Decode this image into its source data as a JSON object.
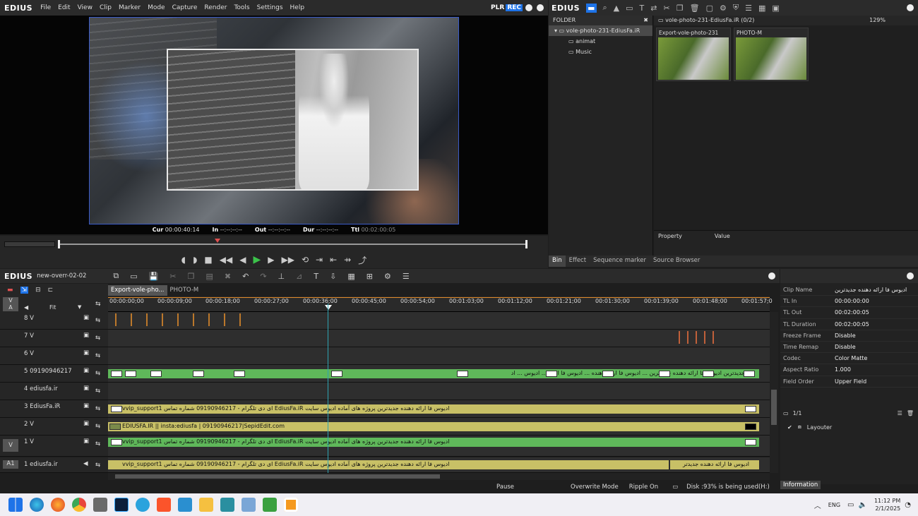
{
  "preview_window": {
    "logo": "EDIUS",
    "menu": [
      "File",
      "Edit",
      "View",
      "Clip",
      "Marker",
      "Mode",
      "Capture",
      "Render",
      "Tools",
      "Settings",
      "Help"
    ],
    "plr": "PLR",
    "rec": "REC",
    "timecodes": {
      "cur_label": "Cur",
      "cur": "00:00:40:14",
      "in_label": "In",
      "in": "--:--:--:--",
      "out_label": "Out",
      "out": "--:--:--:--",
      "dur_label": "Dur",
      "dur": "--:--:--:--",
      "ttl_label": "Ttl",
      "ttl": "00:02:00:05"
    }
  },
  "bin": {
    "logo": "EDIUS",
    "folder_header": "FOLDER",
    "root": "vole-photo-231-EdiusFa.iR",
    "folders": [
      "animat",
      "Music"
    ],
    "path": "vole-photo-231-EdiusFa.iR (0/2)",
    "zoom": "129%",
    "clips": [
      {
        "name": "Export-vole-photo-231"
      },
      {
        "name": "PHOTO-M"
      }
    ],
    "prop_cols": [
      "Property",
      "Value"
    ],
    "tabs": [
      "Bin",
      "Effect",
      "Sequence marker",
      "Source Browser"
    ]
  },
  "timeline": {
    "logo": "EDIUS",
    "project": "new-overr-02-02",
    "seq_tabs": [
      "Export-vole-pho...",
      "PHOTO-M"
    ],
    "fit": "Fit",
    "ruler": [
      "00:00:00;00",
      "00:00:09;00",
      "00:00:18;00",
      "00:00:27;00",
      "00:00:36;00",
      "00:00:45;00",
      "00:00:54;00",
      "00:01:03;00",
      "00:01:12;00",
      "00:01:21;00",
      "00:01:30;00",
      "00:01:39;00",
      "00:01:48;00",
      "00:01:57;0"
    ],
    "tracks": [
      {
        "name": "8 V"
      },
      {
        "name": "7 V"
      },
      {
        "name": "6 V"
      },
      {
        "name": "5 09190946217",
        "clip_text": "جدیدترین  ادیوس فا ارائه دهنده جدیدترین ... ادیوس فا ارائه دهنده ... ادیوس فا ارائه ... ادیوس ... اد"
      },
      {
        "name": "4 ediusfa.ir"
      },
      {
        "name": "3 EdiusFa.iR",
        "clip_text": "ادیوس فا ارائه دهنده جدیدترین پروژه های آماده ادیوس سایت EdiusFa.iR  ای دی تلگرام - 09190946217 شماره تماس  vvip_support1"
      },
      {
        "name": "2 V",
        "clip_text": "EDIUSFA.IR || insta:ediusfa |  09190946217|SepidEdit.com"
      },
      {
        "name": "1 V",
        "clip_text": "ادیوس فا ارائه دهنده جدیدترین پروژه های آماده ادیوس سایت EdiusFa.iR  ای دی تلگرام - 09190946217 شماره تماس  vvip_support1"
      },
      {
        "name": "1 ediusfa.ir",
        "clip_text": "ادیوس فا ارائه دهنده جدیدترین پروژه های آماده ادیوس سایت EdiusFa.iR  ای دی تلگرام - 09190946217 شماره تماس  vvip_support1",
        "clip_text2": "ادیوس فا ارائه دهنده جدیدتر"
      }
    ],
    "track_labels": {
      "v": "V",
      "a": "A",
      "a1": "A1"
    }
  },
  "info": {
    "rows": [
      {
        "k": "Clip Name",
        "v": "ادیوس فا ارائه دهنده جدیدترین"
      },
      {
        "k": "TL In",
        "v": "00:00:00:00"
      },
      {
        "k": "TL Out",
        "v": "00:02:00:05"
      },
      {
        "k": "TL Duration",
        "v": "00:02:00:05"
      },
      {
        "k": "Freeze Frame",
        "v": "Disable"
      },
      {
        "k": "Time Remap",
        "v": "Disable"
      },
      {
        "k": "Codec",
        "v": "Color Matte"
      },
      {
        "k": "Aspect Ratio",
        "v": "1.000"
      },
      {
        "k": "Field Order",
        "v": "Upper Field"
      }
    ],
    "page": "1/1",
    "layouter": "Layouter",
    "tab": "Information"
  },
  "status": {
    "pause": "Pause",
    "overwrite": "Overwrite Mode",
    "ripple": "Ripple On",
    "disk": "Disk :93% is being used(H:)"
  },
  "taskbar": {
    "lang": "ENG",
    "time": "11:12 PM",
    "date": "2/1/2025"
  },
  "colors": {
    "green_clip": "#5fb85a",
    "yellow_clip": "#c8c066",
    "rec_blue": "#1e73e8",
    "playhead": "#2fa4b3"
  }
}
